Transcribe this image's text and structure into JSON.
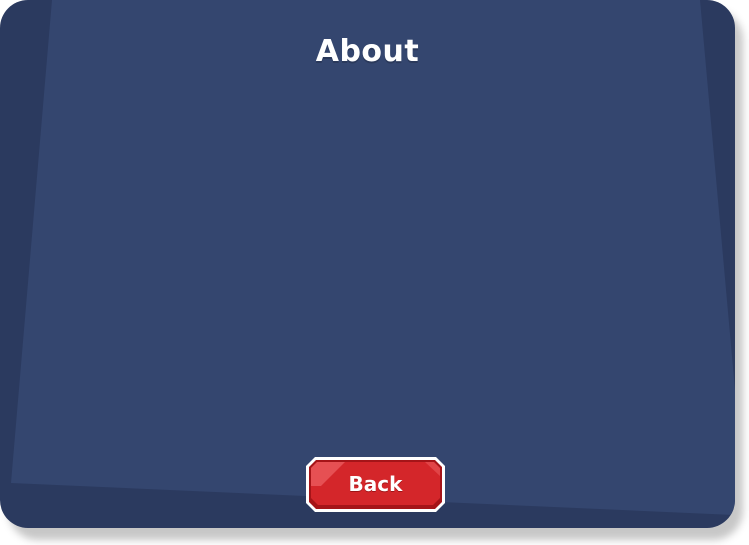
{
  "dialog": {
    "title": "About",
    "back_label": "Back"
  },
  "colors": {
    "panel_dark": "#2b3a5f",
    "panel_light": "#34466f",
    "button_red": "#d4262a",
    "button_border": "#ffffff"
  }
}
